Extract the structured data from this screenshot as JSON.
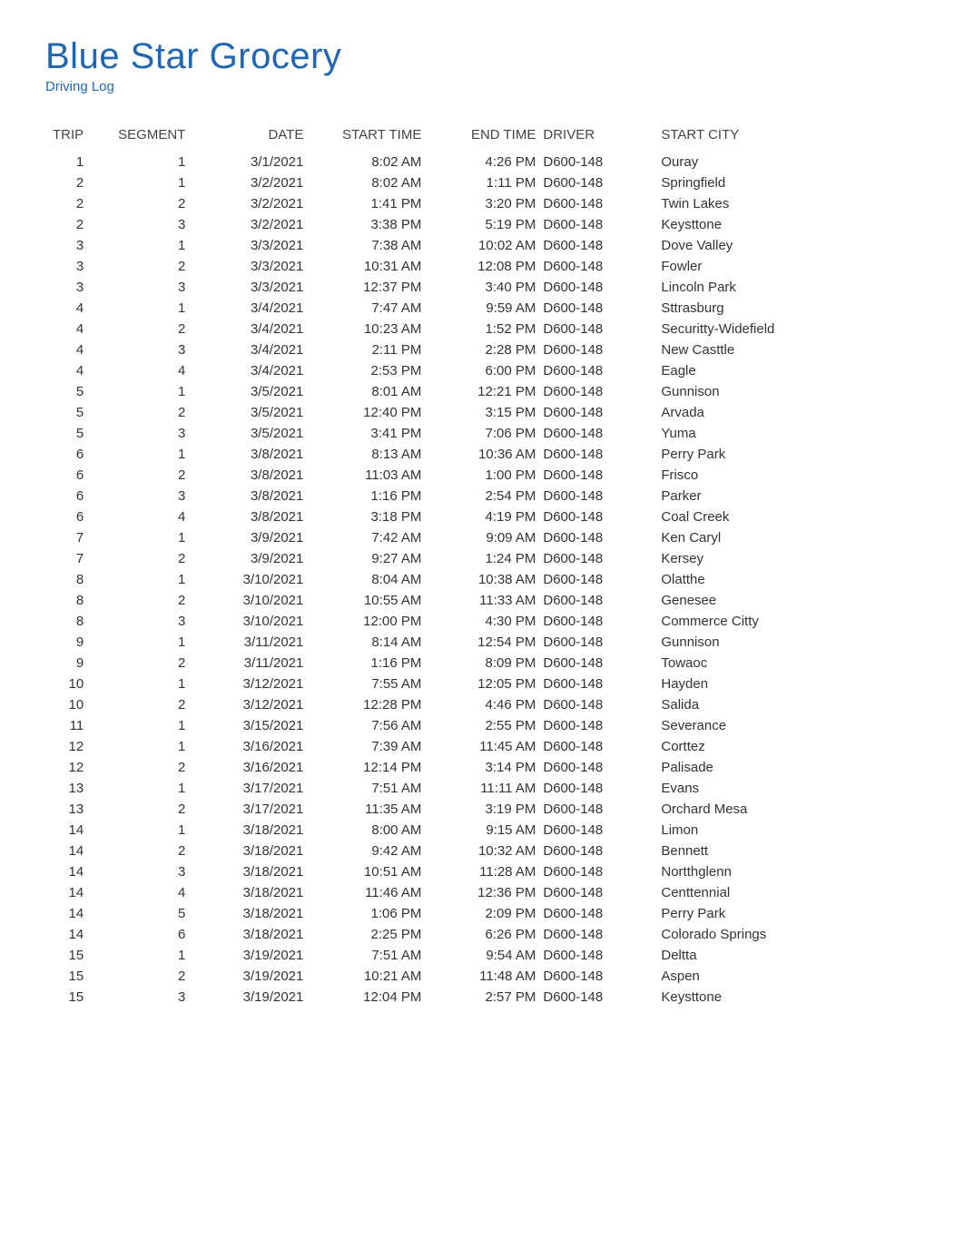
{
  "header": {
    "title": "Blue Star Grocery",
    "subtitle": "Driving Log"
  },
  "columns": [
    "TRIP",
    "SEGMENT",
    "DATE",
    "START TIME",
    "END TIME",
    "DRIVER",
    "START CITY"
  ],
  "rows": [
    {
      "trip": 1,
      "segment": 1,
      "date": "3/1/2021",
      "start": "8:02 AM",
      "end": "4:26 PM",
      "driver": "D600-148",
      "city": "Ouray"
    },
    {
      "trip": 2,
      "segment": 1,
      "date": "3/2/2021",
      "start": "8:02 AM",
      "end": "1:11 PM",
      "driver": "D600-148",
      "city": "Springfield"
    },
    {
      "trip": 2,
      "segment": 2,
      "date": "3/2/2021",
      "start": "1:41 PM",
      "end": "3:20 PM",
      "driver": "D600-148",
      "city": "Twin Lakes"
    },
    {
      "trip": 2,
      "segment": 3,
      "date": "3/2/2021",
      "start": "3:38 PM",
      "end": "5:19 PM",
      "driver": "D600-148",
      "city": "Keysttone"
    },
    {
      "trip": 3,
      "segment": 1,
      "date": "3/3/2021",
      "start": "7:38 AM",
      "end": "10:02 AM",
      "driver": "D600-148",
      "city": "Dove Valley"
    },
    {
      "trip": 3,
      "segment": 2,
      "date": "3/3/2021",
      "start": "10:31 AM",
      "end": "12:08 PM",
      "driver": "D600-148",
      "city": "Fowler"
    },
    {
      "trip": 3,
      "segment": 3,
      "date": "3/3/2021",
      "start": "12:37 PM",
      "end": "3:40 PM",
      "driver": "D600-148",
      "city": "Lincoln Park"
    },
    {
      "trip": 4,
      "segment": 1,
      "date": "3/4/2021",
      "start": "7:47 AM",
      "end": "9:59 AM",
      "driver": "D600-148",
      "city": "Sttrasburg"
    },
    {
      "trip": 4,
      "segment": 2,
      "date": "3/4/2021",
      "start": "10:23 AM",
      "end": "1:52 PM",
      "driver": "D600-148",
      "city": "Securitty-Widefield"
    },
    {
      "trip": 4,
      "segment": 3,
      "date": "3/4/2021",
      "start": "2:11 PM",
      "end": "2:28 PM",
      "driver": "D600-148",
      "city": "New Casttle"
    },
    {
      "trip": 4,
      "segment": 4,
      "date": "3/4/2021",
      "start": "2:53 PM",
      "end": "6:00 PM",
      "driver": "D600-148",
      "city": "Eagle"
    },
    {
      "trip": 5,
      "segment": 1,
      "date": "3/5/2021",
      "start": "8:01 AM",
      "end": "12:21 PM",
      "driver": "D600-148",
      "city": "Gunnison"
    },
    {
      "trip": 5,
      "segment": 2,
      "date": "3/5/2021",
      "start": "12:40 PM",
      "end": "3:15 PM",
      "driver": "D600-148",
      "city": "Arvada"
    },
    {
      "trip": 5,
      "segment": 3,
      "date": "3/5/2021",
      "start": "3:41 PM",
      "end": "7:06 PM",
      "driver": "D600-148",
      "city": "Yuma"
    },
    {
      "trip": 6,
      "segment": 1,
      "date": "3/8/2021",
      "start": "8:13 AM",
      "end": "10:36 AM",
      "driver": "D600-148",
      "city": "Perry Park"
    },
    {
      "trip": 6,
      "segment": 2,
      "date": "3/8/2021",
      "start": "11:03 AM",
      "end": "1:00 PM",
      "driver": "D600-148",
      "city": "Frisco"
    },
    {
      "trip": 6,
      "segment": 3,
      "date": "3/8/2021",
      "start": "1:16 PM",
      "end": "2:54 PM",
      "driver": "D600-148",
      "city": "Parker"
    },
    {
      "trip": 6,
      "segment": 4,
      "date": "3/8/2021",
      "start": "3:18 PM",
      "end": "4:19 PM",
      "driver": "D600-148",
      "city": "Coal Creek"
    },
    {
      "trip": 7,
      "segment": 1,
      "date": "3/9/2021",
      "start": "7:42 AM",
      "end": "9:09 AM",
      "driver": "D600-148",
      "city": "Ken Caryl"
    },
    {
      "trip": 7,
      "segment": 2,
      "date": "3/9/2021",
      "start": "9:27 AM",
      "end": "1:24 PM",
      "driver": "D600-148",
      "city": "Kersey"
    },
    {
      "trip": 8,
      "segment": 1,
      "date": "3/10/2021",
      "start": "8:04 AM",
      "end": "10:38 AM",
      "driver": "D600-148",
      "city": "Olatthe"
    },
    {
      "trip": 8,
      "segment": 2,
      "date": "3/10/2021",
      "start": "10:55 AM",
      "end": "11:33 AM",
      "driver": "D600-148",
      "city": "Genesee"
    },
    {
      "trip": 8,
      "segment": 3,
      "date": "3/10/2021",
      "start": "12:00 PM",
      "end": "4:30 PM",
      "driver": "D600-148",
      "city": "Commerce Citty"
    },
    {
      "trip": 9,
      "segment": 1,
      "date": "3/11/2021",
      "start": "8:14 AM",
      "end": "12:54 PM",
      "driver": "D600-148",
      "city": "Gunnison"
    },
    {
      "trip": 9,
      "segment": 2,
      "date": "3/11/2021",
      "start": "1:16 PM",
      "end": "8:09 PM",
      "driver": "D600-148",
      "city": "Towaoc"
    },
    {
      "trip": 10,
      "segment": 1,
      "date": "3/12/2021",
      "start": "7:55 AM",
      "end": "12:05 PM",
      "driver": "D600-148",
      "city": "Hayden"
    },
    {
      "trip": 10,
      "segment": 2,
      "date": "3/12/2021",
      "start": "12:28 PM",
      "end": "4:46 PM",
      "driver": "D600-148",
      "city": "Salida"
    },
    {
      "trip": 11,
      "segment": 1,
      "date": "3/15/2021",
      "start": "7:56 AM",
      "end": "2:55 PM",
      "driver": "D600-148",
      "city": "Severance"
    },
    {
      "trip": 12,
      "segment": 1,
      "date": "3/16/2021",
      "start": "7:39 AM",
      "end": "11:45 AM",
      "driver": "D600-148",
      "city": "Corttez"
    },
    {
      "trip": 12,
      "segment": 2,
      "date": "3/16/2021",
      "start": "12:14 PM",
      "end": "3:14 PM",
      "driver": "D600-148",
      "city": "Palisade"
    },
    {
      "trip": 13,
      "segment": 1,
      "date": "3/17/2021",
      "start": "7:51 AM",
      "end": "11:11 AM",
      "driver": "D600-148",
      "city": "Evans"
    },
    {
      "trip": 13,
      "segment": 2,
      "date": "3/17/2021",
      "start": "11:35 AM",
      "end": "3:19 PM",
      "driver": "D600-148",
      "city": "Orchard Mesa"
    },
    {
      "trip": 14,
      "segment": 1,
      "date": "3/18/2021",
      "start": "8:00 AM",
      "end": "9:15 AM",
      "driver": "D600-148",
      "city": "Limon"
    },
    {
      "trip": 14,
      "segment": 2,
      "date": "3/18/2021",
      "start": "9:42 AM",
      "end": "10:32 AM",
      "driver": "D600-148",
      "city": "Bennett"
    },
    {
      "trip": 14,
      "segment": 3,
      "date": "3/18/2021",
      "start": "10:51 AM",
      "end": "11:28 AM",
      "driver": "D600-148",
      "city": "Nortthglenn"
    },
    {
      "trip": 14,
      "segment": 4,
      "date": "3/18/2021",
      "start": "11:46 AM",
      "end": "12:36 PM",
      "driver": "D600-148",
      "city": "Centtennial"
    },
    {
      "trip": 14,
      "segment": 5,
      "date": "3/18/2021",
      "start": "1:06 PM",
      "end": "2:09 PM",
      "driver": "D600-148",
      "city": "Perry Park"
    },
    {
      "trip": 14,
      "segment": 6,
      "date": "3/18/2021",
      "start": "2:25 PM",
      "end": "6:26 PM",
      "driver": "D600-148",
      "city": "Colorado Springs"
    },
    {
      "trip": 15,
      "segment": 1,
      "date": "3/19/2021",
      "start": "7:51 AM",
      "end": "9:54 AM",
      "driver": "D600-148",
      "city": "Deltta"
    },
    {
      "trip": 15,
      "segment": 2,
      "date": "3/19/2021",
      "start": "10:21 AM",
      "end": "11:48 AM",
      "driver": "D600-148",
      "city": "Aspen"
    },
    {
      "trip": 15,
      "segment": 3,
      "date": "3/19/2021",
      "start": "12:04 PM",
      "end": "2:57 PM",
      "driver": "D600-148",
      "city": "Keysttone"
    }
  ]
}
